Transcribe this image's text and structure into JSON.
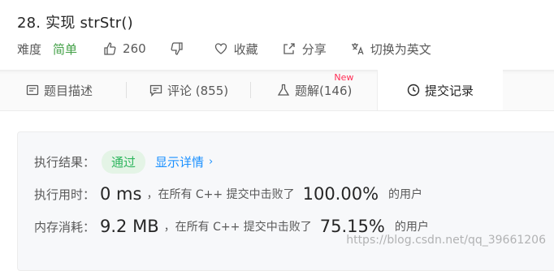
{
  "header": {
    "title": "28. 实现 strStr()",
    "difficulty_label": "难度",
    "difficulty_value": "简单",
    "likes": "260",
    "favorite_label": "收藏",
    "share_label": "分享",
    "translate_label": "切换为英文"
  },
  "tabs": [
    {
      "label": "题目描述"
    },
    {
      "label": "评论 (855)"
    },
    {
      "label": "题解(146)",
      "badge": "New"
    },
    {
      "label": "提交记录"
    }
  ],
  "result": {
    "label": "执行结果：",
    "status": "通过",
    "details_link": "显示详情",
    "time_label": "执行用时：",
    "time_value": "0 ms",
    "time_mid": "，在所有 C++ 提交中击败了",
    "time_pct": "100.00%",
    "time_tail": "的用户",
    "mem_label": "内存消耗：",
    "mem_value": "9.2 MB",
    "mem_mid": "，在所有 C++ 提交中击败了",
    "mem_pct": "75.15%",
    "mem_tail": "的用户"
  },
  "watermark": "https://blog.csdn.net/qq_39661206",
  "colors": {
    "accent_green": "#2db55d",
    "link_blue": "#1a90ff",
    "badge_red": "#ff2d55"
  }
}
